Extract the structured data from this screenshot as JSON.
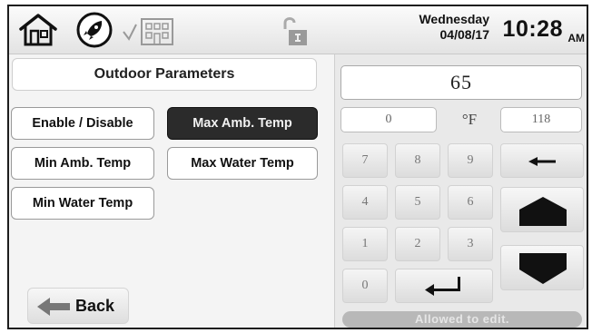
{
  "header": {
    "day": "Wednesday",
    "date": "04/08/17",
    "time": "10:28",
    "ampm": "AM",
    "icons": [
      "home-icon",
      "rocket-icon",
      "building-icon",
      "lock-icon"
    ]
  },
  "left_panel": {
    "title": "Outdoor Parameters",
    "buttons": {
      "enable_disable": "Enable / Disable",
      "max_amb_temp": "Max Amb. Temp",
      "min_amb_temp": "Min Amb. Temp",
      "max_water_temp": "Max Water Temp",
      "min_water_temp": "Min Water Temp"
    },
    "selected": "Max Amb. Temp",
    "back_label": "Back"
  },
  "keypad": {
    "value": "65",
    "min": "0",
    "unit": "°F",
    "max": "118",
    "keys": {
      "k7": "7",
      "k8": "8",
      "k9": "9",
      "k4": "4",
      "k5": "5",
      "k6": "6",
      "k1": "1",
      "k2": "2",
      "k3": "3",
      "k0": "0"
    },
    "status": "Allowed to edit."
  },
  "colors": {
    "selected_button_bg": "#2b2b2b",
    "status_bar_bg": "#b8b8b8"
  }
}
